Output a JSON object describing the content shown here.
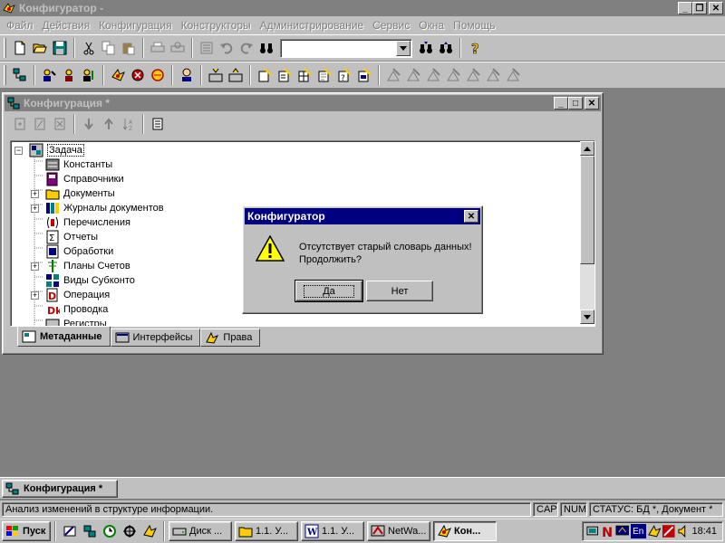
{
  "app": {
    "title": "Конфигуратор -"
  },
  "menu": [
    "Файл",
    "Действия",
    "Конфигурация",
    "Конструкторы",
    "Администрирование",
    "Сервис",
    "Окна",
    "Помощь"
  ],
  "colors": {
    "desktop": "#808080",
    "dialog_title": "#000080",
    "face": "#c0c0c0"
  },
  "config_window": {
    "title": "Конфигурация *",
    "tree": [
      {
        "label": "Задача",
        "icon": "task-icon",
        "level": 0,
        "expander": "minus",
        "selected": true
      },
      {
        "label": "Константы",
        "icon": "constants-icon",
        "level": 1,
        "expander": ""
      },
      {
        "label": "Справочники",
        "icon": "catalogs-icon",
        "level": 1,
        "expander": ""
      },
      {
        "label": "Документы",
        "icon": "folder-icon",
        "level": 1,
        "expander": "plus"
      },
      {
        "label": "Журналы документов",
        "icon": "journal-icon",
        "level": 1,
        "expander": "plus"
      },
      {
        "label": "Перечисления",
        "icon": "enum-icon",
        "level": 1,
        "expander": ""
      },
      {
        "label": "Отчеты",
        "icon": "report-icon",
        "level": 1,
        "expander": ""
      },
      {
        "label": "Обработки",
        "icon": "processing-icon",
        "level": 1,
        "expander": ""
      },
      {
        "label": "Планы Счетов",
        "icon": "accounts-icon",
        "level": 1,
        "expander": "plus"
      },
      {
        "label": "Виды Субконто",
        "icon": "subconto-icon",
        "level": 1,
        "expander": ""
      },
      {
        "label": "Операция",
        "icon": "operation-icon",
        "level": 1,
        "expander": "plus"
      },
      {
        "label": "Проводка",
        "icon": "entry-icon",
        "level": 1,
        "expander": ""
      },
      {
        "label": "Регистры",
        "icon": "registers-icon",
        "level": 1,
        "expander": ""
      }
    ],
    "tabs": [
      {
        "label": "Метаданные",
        "active": true
      },
      {
        "label": "Интерфейсы",
        "active": false
      },
      {
        "label": "Права",
        "active": false
      }
    ]
  },
  "dialog": {
    "title": "Конфигуратор",
    "message_line1": "Отсутствует старый словарь данных!",
    "message_line2": "Продолжить?",
    "yes_label": "Да",
    "no_label": "Нет"
  },
  "window_bar": {
    "label": "Конфигурация *"
  },
  "status": {
    "text": "Анализ изменений в структуре информации.",
    "cap": "CAP",
    "num": "NUM",
    "state": "СТАТУС: БД *, Документ *"
  },
  "taskbar": {
    "start_label": "Пуск",
    "items": [
      {
        "label": "Диск ...",
        "active": false
      },
      {
        "label": "1.1. У...",
        "active": false
      },
      {
        "label": "1.1. У...",
        "active": false
      },
      {
        "label": "NetWa...",
        "active": false
      },
      {
        "label": "Кон...",
        "active": true
      }
    ],
    "lang": "En",
    "clock": "18:41"
  }
}
